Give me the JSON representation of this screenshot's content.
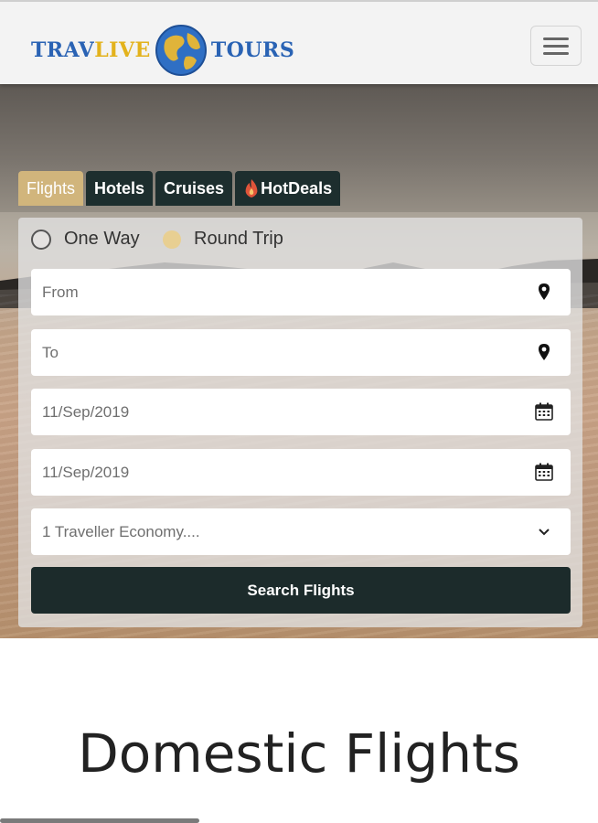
{
  "brand": {
    "logo_left": "TRAV",
    "logo_mid": "LIVE",
    "logo_right": "TOURS",
    "globe_icon": "globe-icon"
  },
  "header": {
    "menu_icon": "hamburger-menu-icon"
  },
  "tabs": [
    {
      "label": "Flights",
      "active": true
    },
    {
      "label": "Hotels",
      "active": false
    },
    {
      "label": "Cruises",
      "active": false
    },
    {
      "label": "HotDeals",
      "active": false,
      "icon": "fire-icon"
    }
  ],
  "trip_type": {
    "options": [
      {
        "label": "One Way",
        "selected": false
      },
      {
        "label": "Round Trip",
        "selected": true
      }
    ]
  },
  "form": {
    "from_placeholder": "From",
    "to_placeholder": "To",
    "depart_date": "11/Sep/2019",
    "return_date": "11/Sep/2019",
    "travellers": "1 Traveller Economy....",
    "search_label": "Search Flights"
  },
  "section": {
    "title": "Domestic Flights"
  },
  "colors": {
    "accent_tab": "#d1b57c",
    "dark": "#1c2b2b",
    "logo_blue": "#2a63b4",
    "logo_gold": "#e3b21c"
  }
}
